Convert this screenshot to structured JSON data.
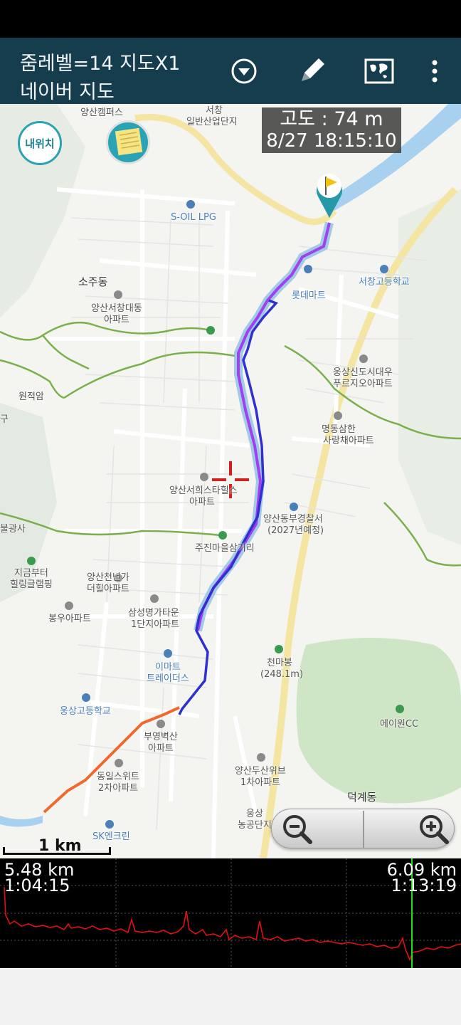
{
  "app_bar": {
    "title_line1": "줌레벨=14 지도X1",
    "title_line2": "네이버 지도",
    "icons": [
      "dropdown-circle-icon",
      "pencil-icon",
      "world-map-icon",
      "more-vert-icon"
    ]
  },
  "map": {
    "my_location_label": "내위치",
    "tooltip": {
      "altitude": "고도 : 74 m",
      "datetime": "8/27 18:15:10"
    },
    "labels": {
      "yangsan_campus": "양산캠퍼스",
      "seochang": "서창",
      "industrial": "일반산업단지",
      "soil": "S-OIL LPG",
      "sojudong": "소주동",
      "apt_seochang_1": "양산서창대동",
      "apt_seochang_2": "아파트",
      "lotte": "롯데마트",
      "seochang_high": "서창고등학교",
      "woongsang_apt_1": "웅상신도시대우",
      "woongsang_apt_2": "푸르지오아파트",
      "wonjeokam": "원적암",
      "myeongdong_1": "명동삼한",
      "myeongdong_2": "사랑채아파트",
      "seohee_1": "양산서희스타힐스",
      "seohee_2": "아파트",
      "police_1": "양산동부경찰서",
      "police_2": "(2027년예정)",
      "bulgwangsa": "불광사",
      "jujin": "주진마을삼거리",
      "healing_1": "지금부터",
      "healing_2": "힐링글램핑",
      "cheonnyeon_1": "양산천년가",
      "cheonnyeon_2": "더힐아파트",
      "samsung_1": "삼성명가타운",
      "samsung_2": "1단지아파트",
      "bongwoo": "봉우아파트",
      "emart_1": "이마트",
      "emart_2": "트레이더스",
      "cheonmabong_1": "천마봉",
      "cheonmabong_2": "(248.1m)",
      "woongsang_high": "웅상고등학교",
      "buyoung_1": "부영벽산",
      "buyoung_2": "아파트",
      "aone": "에이원CC",
      "dongil_1": "동일스위트",
      "dongil_2": "2차아파트",
      "dusan_1": "양산두산위브",
      "dusan_2": "1차아파트",
      "deokgye": "덕계동",
      "woongsang_ag_1": "웅상",
      "woongsang_ag_2": "농공단지",
      "sk": "SK엔크린",
      "gu": "구"
    },
    "scale_label": "1 km",
    "zoom_out_icon": "zoom-out-icon",
    "zoom_in_icon": "zoom-in-icon"
  },
  "profile": {
    "left_distance": "5.48 km",
    "left_time": "1:04:15",
    "right_distance": "6.09 km",
    "right_time": "1:13:19"
  },
  "colors": {
    "app_bar": "#163d4d",
    "track_purple": "#9b30f0",
    "track_blue": "#3535d0",
    "track_orange": "#f06a30",
    "profile_line": "#e01010",
    "cursor_line": "#19e019"
  }
}
